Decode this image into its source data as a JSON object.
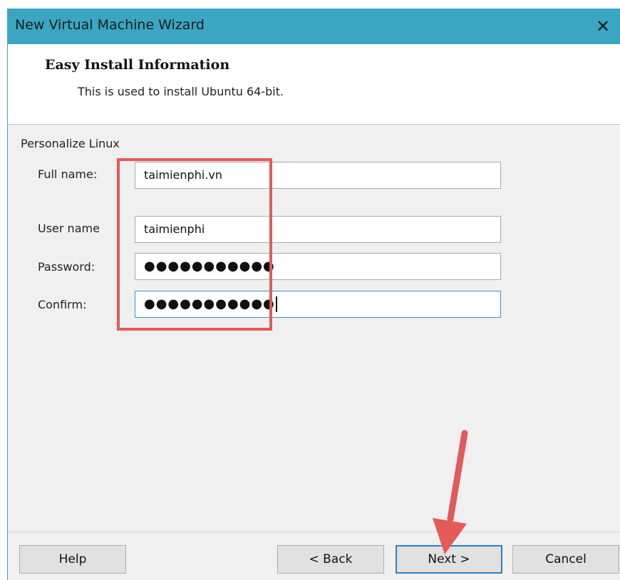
{
  "window": {
    "title": "New Virtual Machine Wizard",
    "close_glyph": "✕"
  },
  "header": {
    "title": "Easy Install Information",
    "subtitle": "This is used to install Ubuntu 64-bit."
  },
  "form": {
    "group_label": "Personalize Linux",
    "fields": [
      {
        "label": "Full name:",
        "value": "taimienphi.vn"
      },
      {
        "label": "User name",
        "value": "taimienphi"
      },
      {
        "label": "Password:",
        "value": "●●●●●●●●●●●"
      },
      {
        "label": "Confirm:",
        "value": "●●●●●●●●●●●"
      }
    ]
  },
  "buttons": {
    "help": "Help",
    "back": "< Back",
    "next": "Next >",
    "cancel": "Cancel"
  },
  "colors": {
    "titlebar": "#3aa6c1",
    "annotation": "#e35a5a",
    "focus_border": "#3399cc"
  },
  "icons": {
    "close": "close-icon",
    "annotation_arrow": "arrow-annotation-icon"
  }
}
